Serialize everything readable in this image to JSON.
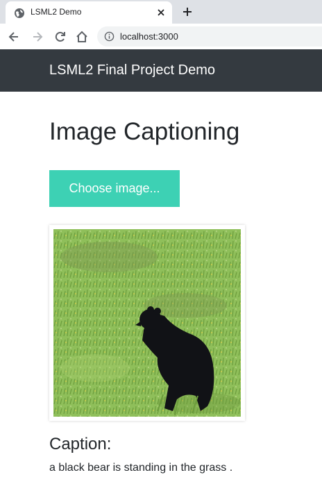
{
  "browser": {
    "tab_title": "LSML2 Demo",
    "url": "localhost:3000",
    "icons": {
      "favicon": "globe-icon",
      "tab_close": "close-icon",
      "new_tab": "plus-icon",
      "back": "back-arrow-icon",
      "forward": "forward-arrow-icon",
      "reload": "reload-icon",
      "home": "home-icon",
      "site_info": "info-icon"
    }
  },
  "navbar": {
    "brand": "LSML2 Final Project Demo",
    "background": "#343a40"
  },
  "main": {
    "title": "Image Captioning",
    "choose_button_label": "Choose image...",
    "accent_color": "#3dd1b4",
    "image_subject": "black bear in green grass",
    "caption_heading": "Caption:",
    "caption_text": "a black bear is standing in the grass ."
  }
}
